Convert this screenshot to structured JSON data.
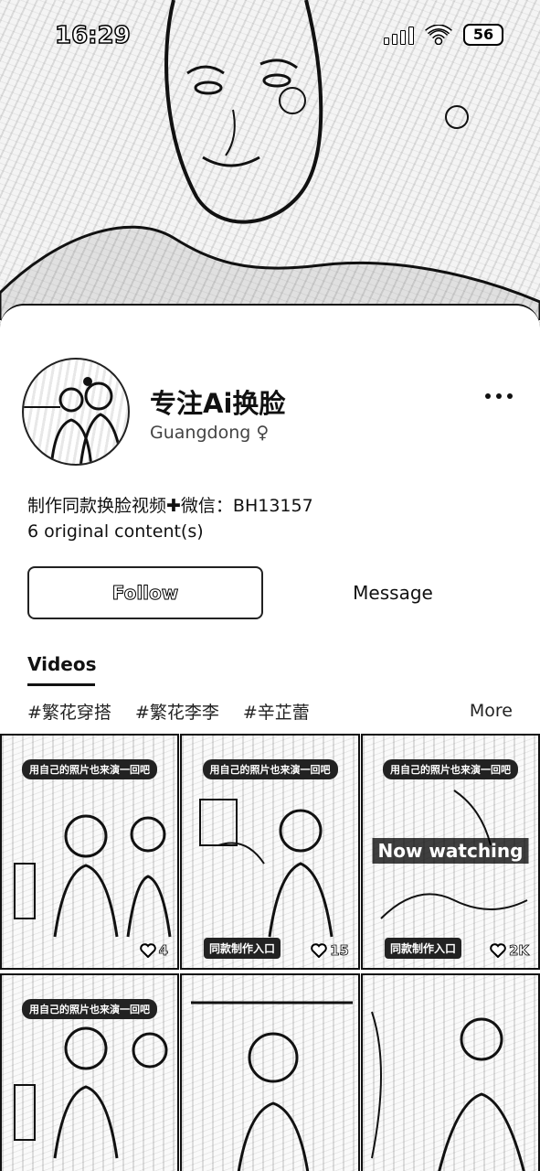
{
  "status_bar": {
    "time": "16:29",
    "battery": "56",
    "icons": [
      "signal-icon",
      "wifi-icon",
      "battery-icon"
    ]
  },
  "profile": {
    "name": "专注Ai换脸",
    "location": "Guangdong ♀",
    "bio": "制作同款换脸视频✚微信：BH13157",
    "content_count": "6 original content(s)"
  },
  "actions": {
    "follow": "Follow",
    "message": "Message"
  },
  "tabs": {
    "videos": "Videos"
  },
  "tags": {
    "items": [
      "#繁花穿搭",
      "#繁花李李",
      "#辛芷蕾"
    ],
    "more": "More"
  },
  "videos": [
    {
      "caption": "用自己的照片也来演一回吧",
      "likes": "4",
      "badge": "",
      "now_watching": ""
    },
    {
      "caption": "用自己的照片也来演一回吧",
      "likes": "15",
      "badge": "同款制作入口",
      "now_watching": ""
    },
    {
      "caption": "用自己的照片也来演一回吧",
      "likes": "2K",
      "badge": "同款制作入口",
      "now_watching": "Now watching"
    },
    {
      "caption": "用自己的照片也来演一回吧",
      "likes": "",
      "badge": "",
      "now_watching": ""
    },
    {
      "caption": "",
      "likes": "",
      "badge": "",
      "now_watching": ""
    },
    {
      "caption": "",
      "likes": "",
      "badge": "",
      "now_watching": ""
    }
  ]
}
